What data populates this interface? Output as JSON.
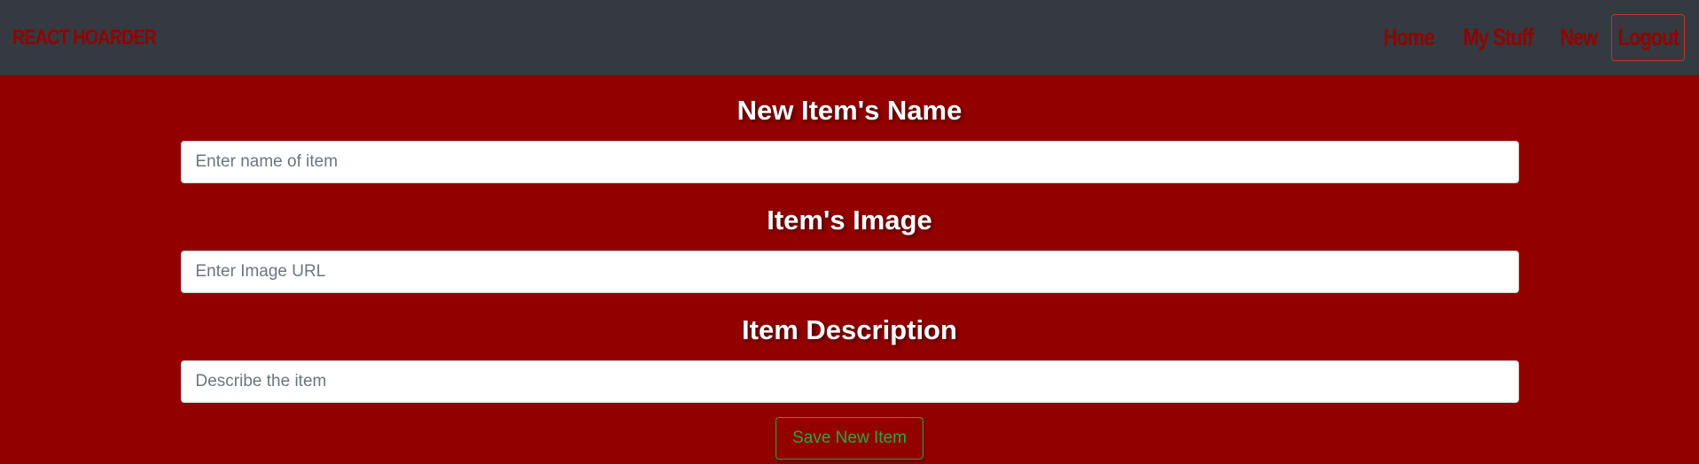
{
  "navbar": {
    "brand": "REACT HOARDER",
    "links": [
      {
        "label": "Home"
      },
      {
        "label": "My Stuff"
      },
      {
        "label": "New"
      }
    ],
    "logout_label": "Logout"
  },
  "form": {
    "name_heading": "New Item's Name",
    "name_placeholder": "Enter name of item",
    "name_value": "",
    "image_heading": "Item's Image",
    "image_placeholder": "Enter Image URL",
    "image_value": "",
    "description_heading": "Item Description",
    "description_placeholder": "Describe the item",
    "description_value": "",
    "save_label": "Save New Item"
  },
  "colors": {
    "navbar_bg": "#343a40",
    "page_bg": "#930000",
    "brand": "#930000",
    "save_accent": "#28a745"
  }
}
